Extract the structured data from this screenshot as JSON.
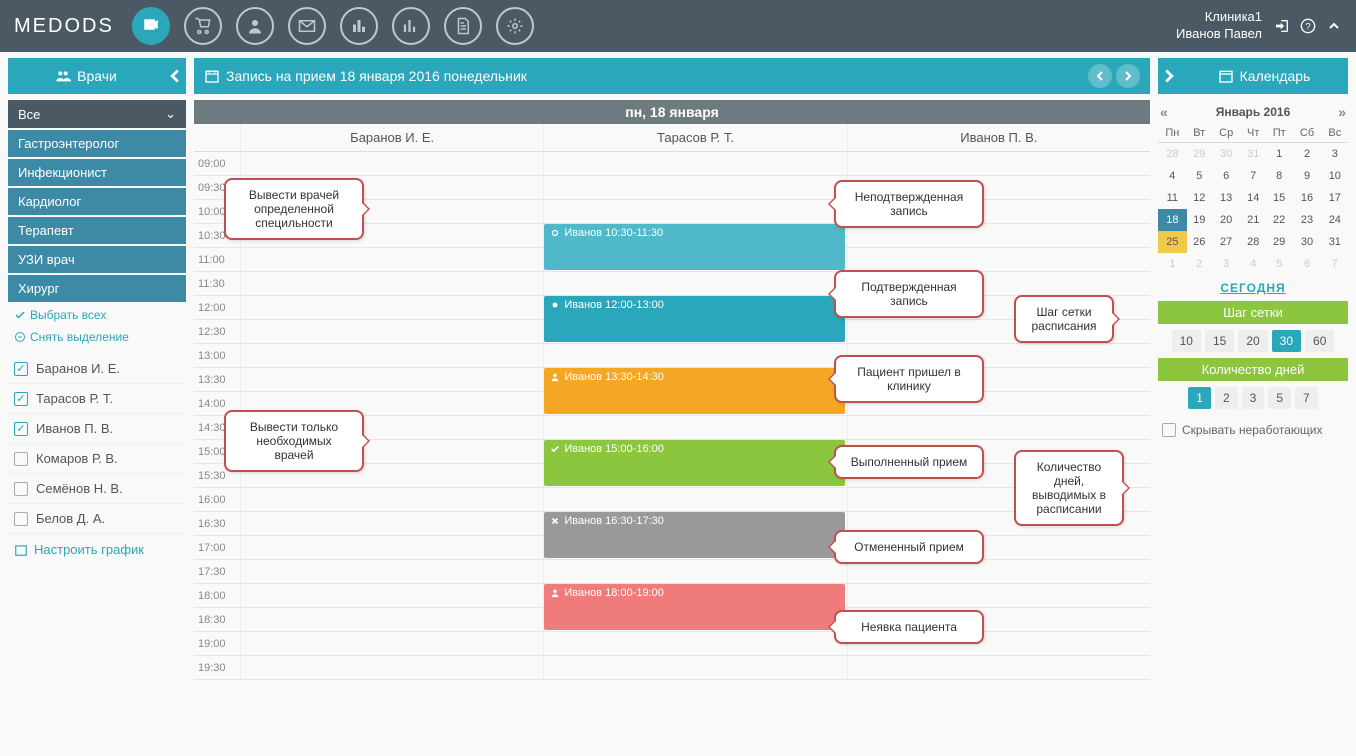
{
  "app": {
    "logo": "MEDODS",
    "clinic": "Клиника1",
    "user": "Иванов Павел"
  },
  "sidebar": {
    "title": "Врачи",
    "all_label": "Все",
    "specs": [
      "Гастроэнтеролог",
      "Инфекционист",
      "Кардиолог",
      "Терапевт",
      "УЗИ врач",
      "Хирург"
    ],
    "select_all": "Выбрать всех",
    "deselect_all": "Снять выделение",
    "doctors": [
      {
        "name": "Баранов И. Е.",
        "on": true
      },
      {
        "name": "Тарасов Р. Т.",
        "on": true
      },
      {
        "name": "Иванов П. В.",
        "on": true
      },
      {
        "name": "Комаров Р. В.",
        "on": false
      },
      {
        "name": "Семёнов Н. В.",
        "on": false
      },
      {
        "name": "Белов Д. А.",
        "on": false
      }
    ],
    "settings": "Настроить график"
  },
  "schedule": {
    "title": "Запись на прием 18 января 2016 понедельник",
    "day_header": "пн, 18 января",
    "doctor_cols": [
      "Баранов И. Е.",
      "Тарасов Р. Т.",
      "Иванов П. В."
    ],
    "times": [
      "09:00",
      "09:30",
      "10:00",
      "10:30",
      "11:00",
      "11:30",
      "12:00",
      "12:30",
      "13:00",
      "13:30",
      "14:00",
      "14:30",
      "15:00",
      "15:30",
      "16:00",
      "16:30",
      "17:00",
      "17:30",
      "18:00",
      "18:30",
      "19:00",
      "19:30"
    ],
    "appts": [
      {
        "row": 3,
        "text": "Иванов 10:30-11:30",
        "cls": "appt-teal unconf",
        "icon": "circle"
      },
      {
        "row": 6,
        "text": "Иванов 12:00-13:00",
        "cls": "appt-teal",
        "icon": "dot"
      },
      {
        "row": 9,
        "text": "Иванов 13:30-14:30",
        "cls": "appt-orange",
        "icon": "user"
      },
      {
        "row": 12,
        "text": "Иванов 15:00-16:00",
        "cls": "appt-green",
        "icon": "check"
      },
      {
        "row": 15,
        "text": "Иванов 16:30-17:30",
        "cls": "appt-gray",
        "icon": "x"
      },
      {
        "row": 18,
        "text": "Иванов 18:00-19:00",
        "cls": "appt-red",
        "icon": "user"
      }
    ]
  },
  "callouts": {
    "c1": "Вывести врачей определенной специльности",
    "c2": "Вывести только необходимых врачей",
    "c3": "Неподтвержденная запись",
    "c4": "Подтвержденная запись",
    "c5": "Пациент пришел в клинику",
    "c6": "Выполненный прием",
    "c7": "Отмененный прием",
    "c8": "Неявка пациента",
    "c9": "Шаг сетки расписания",
    "c10": "Количество дней, выводимых в расписании"
  },
  "calendar": {
    "title": "Календарь",
    "month": "Январь 2016",
    "days_short": [
      "Пн",
      "Вт",
      "Ср",
      "Чт",
      "Пт",
      "Сб",
      "Вс"
    ],
    "weeks": [
      [
        {
          "d": 28,
          "o": 1
        },
        {
          "d": 29,
          "o": 1
        },
        {
          "d": 30,
          "o": 1
        },
        {
          "d": 31,
          "o": 1
        },
        {
          "d": 1
        },
        {
          "d": 2
        },
        {
          "d": 3
        }
      ],
      [
        {
          "d": 4
        },
        {
          "d": 5
        },
        {
          "d": 6
        },
        {
          "d": 7
        },
        {
          "d": 8
        },
        {
          "d": 9
        },
        {
          "d": 10
        }
      ],
      [
        {
          "d": 11
        },
        {
          "d": 12
        },
        {
          "d": 13
        },
        {
          "d": 14
        },
        {
          "d": 15
        },
        {
          "d": 16
        },
        {
          "d": 17
        }
      ],
      [
        {
          "d": 18,
          "sel": 1
        },
        {
          "d": 19
        },
        {
          "d": 20
        },
        {
          "d": 21
        },
        {
          "d": 22
        },
        {
          "d": 23
        },
        {
          "d": 24
        }
      ],
      [
        {
          "d": 25,
          "t": 1
        },
        {
          "d": 26
        },
        {
          "d": 27
        },
        {
          "d": 28
        },
        {
          "d": 29
        },
        {
          "d": 30
        },
        {
          "d": 31
        }
      ],
      [
        {
          "d": 1,
          "o": 1
        },
        {
          "d": 2,
          "o": 1
        },
        {
          "d": 3,
          "o": 1
        },
        {
          "d": 4,
          "o": 1
        },
        {
          "d": 5,
          "o": 1
        },
        {
          "d": 6,
          "o": 1
        },
        {
          "d": 7,
          "o": 1
        }
      ]
    ],
    "today_link": "СЕГОДНЯ",
    "step_header": "Шаг сетки",
    "steps": [
      "10",
      "15",
      "20",
      "30",
      "60"
    ],
    "step_active": "30",
    "days_header": "Количество дней",
    "day_counts": [
      "1",
      "2",
      "3",
      "5",
      "7"
    ],
    "day_active": "1",
    "hide_label": "Скрывать неработающих"
  }
}
